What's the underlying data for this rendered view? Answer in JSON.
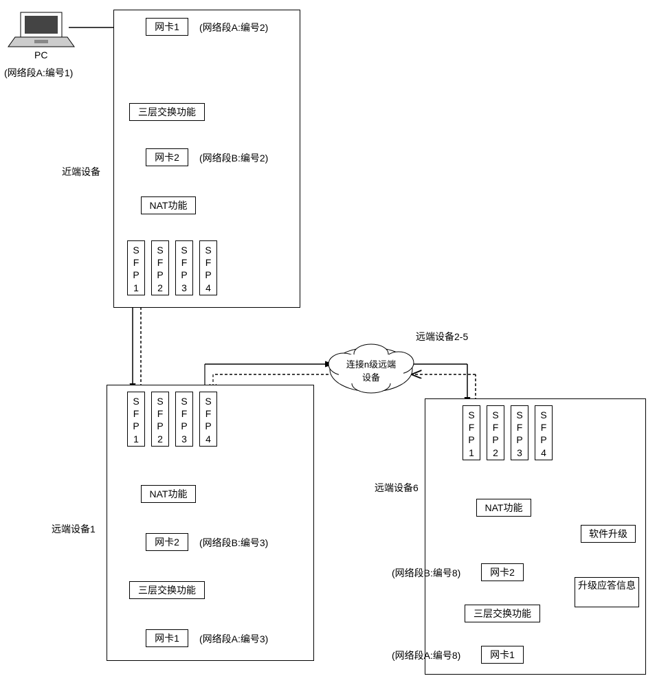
{
  "pc": {
    "label": "PC",
    "segment": "(网络段A:编号1)"
  },
  "near_device": {
    "title": "近端设备",
    "nic1": "网卡1",
    "nic1_seg": "(网络段A:编号2)",
    "l3": "三层交换功能",
    "nic2": "网卡2",
    "nic2_seg": "(网络段B:编号2)",
    "nat": "NAT功能",
    "sfp": [
      "SFP1",
      "SFP2",
      "SFP3",
      "SFP4"
    ]
  },
  "remote1": {
    "title": "远端设备1",
    "nic1": "网卡1",
    "nic1_seg": "(网络段A:编号3)",
    "l3": "三层交换功能",
    "nic2": "网卡2",
    "nic2_seg": "(网络段B:编号3)",
    "nat": "NAT功能",
    "sfp": [
      "SFP1",
      "SFP2",
      "SFP3",
      "SFP4"
    ]
  },
  "remote6": {
    "title": "远端设备6",
    "nic1": "网卡1",
    "nic1_seg": "(网络段A:编号8)",
    "l3": "三层交换功能",
    "nic2": "网卡2",
    "nic2_seg": "(网络段B:编号8)",
    "nat": "NAT功能",
    "sfp": [
      "SFP1",
      "SFP2",
      "SFP3",
      "SFP4"
    ],
    "upgrade": "软件升级",
    "response": "升级应答信息"
  },
  "cloud": {
    "label_side": "远端设备2-5",
    "label_in": "连接n级远端设备"
  }
}
